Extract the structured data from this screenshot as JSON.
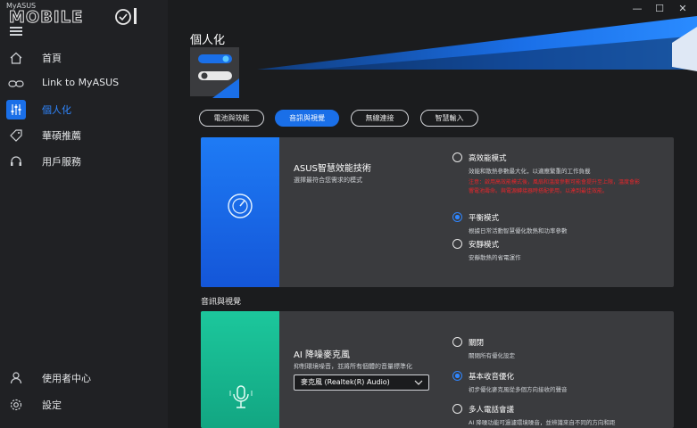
{
  "app": {
    "title": "MyASUS",
    "logo_text": "MOBILE01"
  },
  "window": {
    "minimize": "—",
    "maximize": "☐",
    "close": "✕"
  },
  "sidebar": {
    "items": [
      {
        "label": "首頁",
        "icon": "home-icon"
      },
      {
        "label": "Link to MyASUS",
        "icon": "link-icon"
      },
      {
        "label": "個人化",
        "icon": "sliders-icon",
        "active": true
      },
      {
        "label": "華碩推薦",
        "icon": "tag-icon"
      },
      {
        "label": "用戶服務",
        "icon": "headset-icon"
      }
    ],
    "bottom": [
      {
        "label": "使用者中心",
        "icon": "user-icon"
      },
      {
        "label": "設定",
        "icon": "gear-icon"
      }
    ]
  },
  "main": {
    "title": "個人化",
    "tabs": [
      {
        "label": "電池與效能"
      },
      {
        "label": "音訊與視覺",
        "active": true
      },
      {
        "label": "無線連接"
      },
      {
        "label": "智慧輸入"
      }
    ],
    "performance_card": {
      "title": "ASUS智慧效能技術",
      "desc": "選擇最符合您需求的模式",
      "options": [
        {
          "title": "高效能模式",
          "desc": "效能和散熱參數最大化，以適應繁重的工作負載",
          "warning": "注意：啟用高效能模式後，風扇和溫度參數可能會提升至上限，溫度會影響電池壽命。與電源轉接器時搭配使用，以達到最佳效能。",
          "checked": false
        },
        {
          "title": "平衡模式",
          "desc": "根據日常活動智慧優化散熱和功率參數",
          "checked": true
        },
        {
          "title": "安靜模式",
          "desc": "安靜散熱的省電運作",
          "checked": false
        }
      ]
    },
    "section_label": "音訊與視覺",
    "mic_card": {
      "title": "AI 降噪麥克風",
      "desc": "抑制環境噪音，並將所有個體的音量標準化",
      "select_value": "麥克風 (Realtek(R) Audio)",
      "options": [
        {
          "title": "關閉",
          "desc": "關閉所有優化設定",
          "checked": false
        },
        {
          "title": "基本收音優化",
          "desc": "初步優化麥克風從多個方向接收的聲音",
          "checked": true
        },
        {
          "title": "多人電話會議",
          "desc": "AI 降噪功能可過濾環境噪音，並辨識來自不同的方向和距",
          "checked": false
        }
      ]
    }
  },
  "colors": {
    "accent": "#1a6fe8",
    "perf_card": "#1f6bf0",
    "mic_card": "#17b690",
    "warning": "#e8262b"
  }
}
